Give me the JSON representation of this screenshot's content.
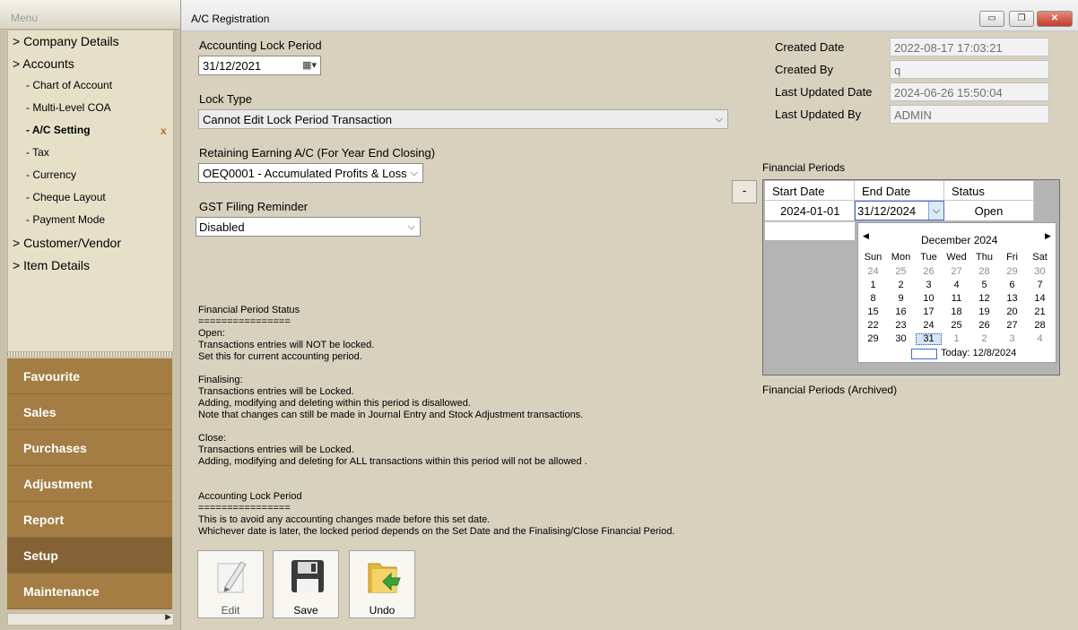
{
  "menu": {
    "title": "Menu",
    "tree": [
      {
        "label": "> Company Details",
        "level": 1
      },
      {
        "label": "> Accounts",
        "level": 1
      },
      {
        "label": "- Chart of Account",
        "level": 2
      },
      {
        "label": "- Multi-Level COA",
        "level": 2
      },
      {
        "label": "- A/C Setting",
        "level": 2,
        "selected": true
      },
      {
        "label": "- Tax",
        "level": 2
      },
      {
        "label": "- Currency",
        "level": 2
      },
      {
        "label": "- Cheque Layout",
        "level": 2
      },
      {
        "label": "- Payment Mode",
        "level": 2
      },
      {
        "label": "> Customer/Vendor",
        "level": 1
      },
      {
        "label": "> Item Details",
        "level": 1
      }
    ],
    "close_glyph": "x",
    "nav": [
      "Favourite",
      "Sales",
      "Purchases",
      "Adjustment",
      "Report",
      "Setup",
      "Maintenance"
    ],
    "active_nav": "Setup"
  },
  "window": {
    "title": "A/C Registration"
  },
  "form": {
    "lock_period_label": "Accounting Lock Period",
    "lock_period_value": "31/12/2021",
    "lock_type_label": "Lock Type",
    "lock_type_value": "Cannot Edit Lock Period Transaction",
    "retaining_label": "Retaining Earning A/C (For Year End Closing)",
    "retaining_value": "OEQ0001 - Accumulated Profits & Loss",
    "gst_label": "GST Filing Reminder",
    "gst_value": "Disabled"
  },
  "meta": {
    "created_date_label": "Created Date",
    "created_date": "2022-08-17 17:03:21",
    "created_by_label": "Created By",
    "created_by": "q",
    "last_updated_date_label": "Last Updated Date",
    "last_updated_date": "2024-06-26 15:50:04",
    "last_updated_by_label": "Last Updated By",
    "last_updated_by": "ADMIN"
  },
  "info_text": {
    "fp_block": "Financial Period Status\n================\nOpen:\nTransactions entries will NOT be locked.\nSet this for current accounting period.\n\nFinalising:\nTransactions entries will be Locked.\nAdding, modifying and deleting within this period is disallowed.\nNote that changes can still be made in Journal Entry and Stock Adjustment transactions.\n\nClose:\nTransactions entries will be Locked.\nAdding, modifying and deleting for ALL transactions within this period will not be allowed .",
    "lock_block": "Accounting Lock Period\n================\nThis is to avoid any accounting changes made before this set date.\nWhichever date is later, the locked period depends on the Set Date and the Finalising/Close Financial Period."
  },
  "financial_periods": {
    "title": "Financial Periods",
    "remove_label": "-",
    "columns": [
      "Start Date",
      "End Date",
      "Status"
    ],
    "rows": [
      {
        "start": "2024-01-01",
        "end": "31/12/2024",
        "status": "Open"
      }
    ],
    "archived_title": "Financial Periods (Archived)"
  },
  "calendar": {
    "month_label": "December 2024",
    "weekdays": [
      "Sun",
      "Mon",
      "Tue",
      "Wed",
      "Thu",
      "Fri",
      "Sat"
    ],
    "weeks": [
      [
        24,
        25,
        26,
        27,
        28,
        29,
        30
      ],
      [
        1,
        2,
        3,
        4,
        5,
        6,
        7
      ],
      [
        8,
        9,
        10,
        11,
        12,
        13,
        14
      ],
      [
        15,
        16,
        17,
        18,
        19,
        20,
        21
      ],
      [
        22,
        23,
        24,
        25,
        26,
        27,
        28
      ],
      [
        29,
        30,
        31,
        1,
        2,
        3,
        4
      ]
    ],
    "selected_day": 31,
    "today_label": "Today: 12/8/2024"
  },
  "actions": {
    "edit": "Edit",
    "save": "Save",
    "undo": "Undo"
  }
}
